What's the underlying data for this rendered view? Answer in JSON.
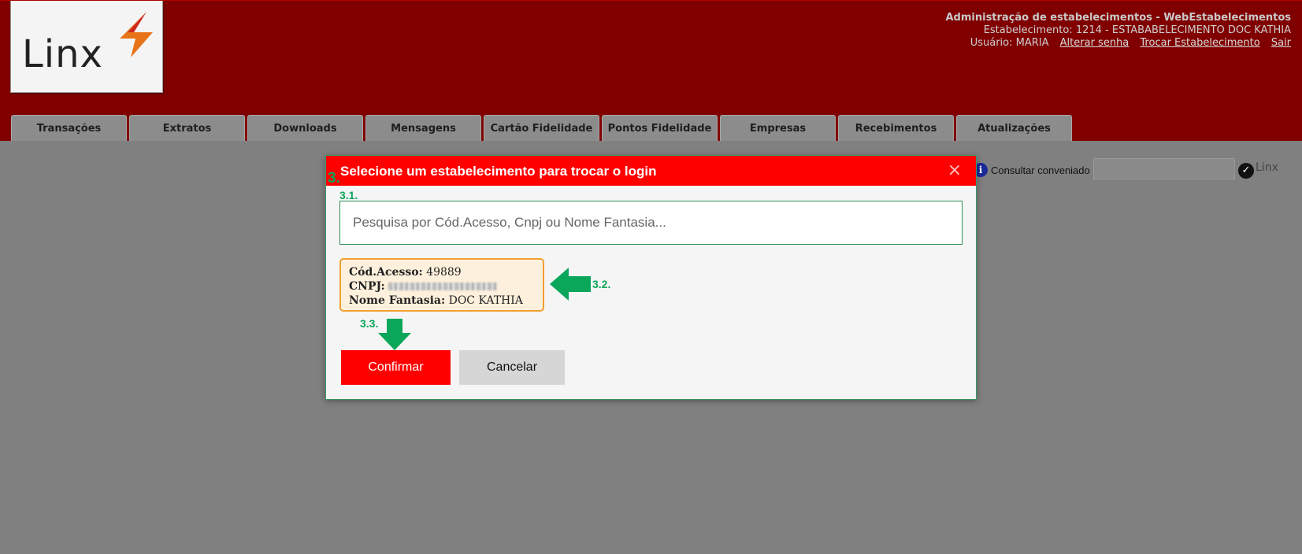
{
  "header": {
    "app_title": "Administração de estabelecimentos - WebEstabelecimentos",
    "establishment": "Estabelecimento: 1214 - ESTABABELECIMENTO DOC KATHIA",
    "user": "Usuário: MARIA",
    "links": {
      "change_password": "Alterar senha",
      "switch_establishment": "Trocar Estabelecimento",
      "logout": "Sair"
    },
    "logo": "Linx"
  },
  "nav": {
    "tabs": [
      "Transações",
      "Extratos",
      "Downloads",
      "Mensagens",
      "Cartão Fidelidade",
      "Pontos Fidelidade",
      "Empresas",
      "Recebimentos",
      "Atualizações"
    ]
  },
  "tools": {
    "consult_label": "Consultar conveniado",
    "info_icon": "i",
    "mini_logo": "Linx"
  },
  "modal": {
    "title": "Selecione um estabelecimento para trocar o login",
    "close_icon": "×",
    "search_placeholder": "Pesquisa por Cód.Acesso, Cnpj ou Nome Fantasia...",
    "result": {
      "code_label": "Cód.Acesso:",
      "code_value": "49889",
      "cnpj_label": "CNPJ:",
      "name_label": "Nome Fantasia:",
      "name_value": "DOC KATHIA"
    },
    "confirm_label": "Confirmar",
    "cancel_label": "Cancelar"
  },
  "annotations": {
    "step": "3.",
    "search": "3.1.",
    "card": "3.2.",
    "confirm": "3.3."
  },
  "colors": {
    "header_bg": "#800000",
    "modal_header": "#ff0000",
    "annotation": "#0aa65a",
    "card_border": "#f0a030"
  }
}
